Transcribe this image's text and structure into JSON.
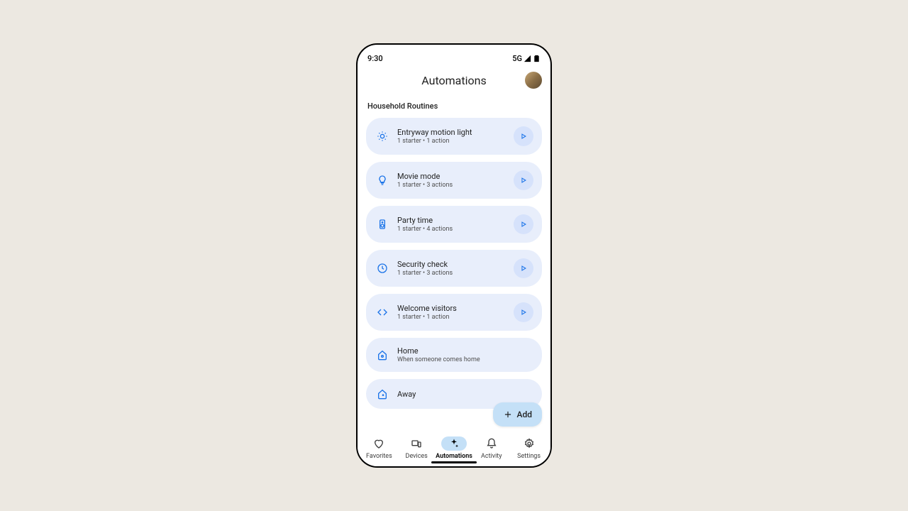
{
  "status": {
    "time": "9:30",
    "network": "5G"
  },
  "header": {
    "title": "Automations"
  },
  "section": {
    "title": "Household Routines"
  },
  "routines": [
    {
      "title": "Entryway motion light",
      "sub": "1 starter • 1 action"
    },
    {
      "title": "Movie mode",
      "sub": "1 starter • 3 actions"
    },
    {
      "title": "Party time",
      "sub": "1 starter • 4 actions"
    },
    {
      "title": "Security check",
      "sub": "1 starter • 3 actions"
    },
    {
      "title": "Welcome visitors",
      "sub": "1 starter • 1 action"
    },
    {
      "title": "Home",
      "sub": "When someone comes home"
    },
    {
      "title": "Away",
      "sub": ""
    }
  ],
  "fab": {
    "label": "Add"
  },
  "nav": {
    "items": [
      {
        "label": "Favorites"
      },
      {
        "label": "Devices"
      },
      {
        "label": "Automations"
      },
      {
        "label": "Activity"
      },
      {
        "label": "Settings"
      }
    ]
  }
}
